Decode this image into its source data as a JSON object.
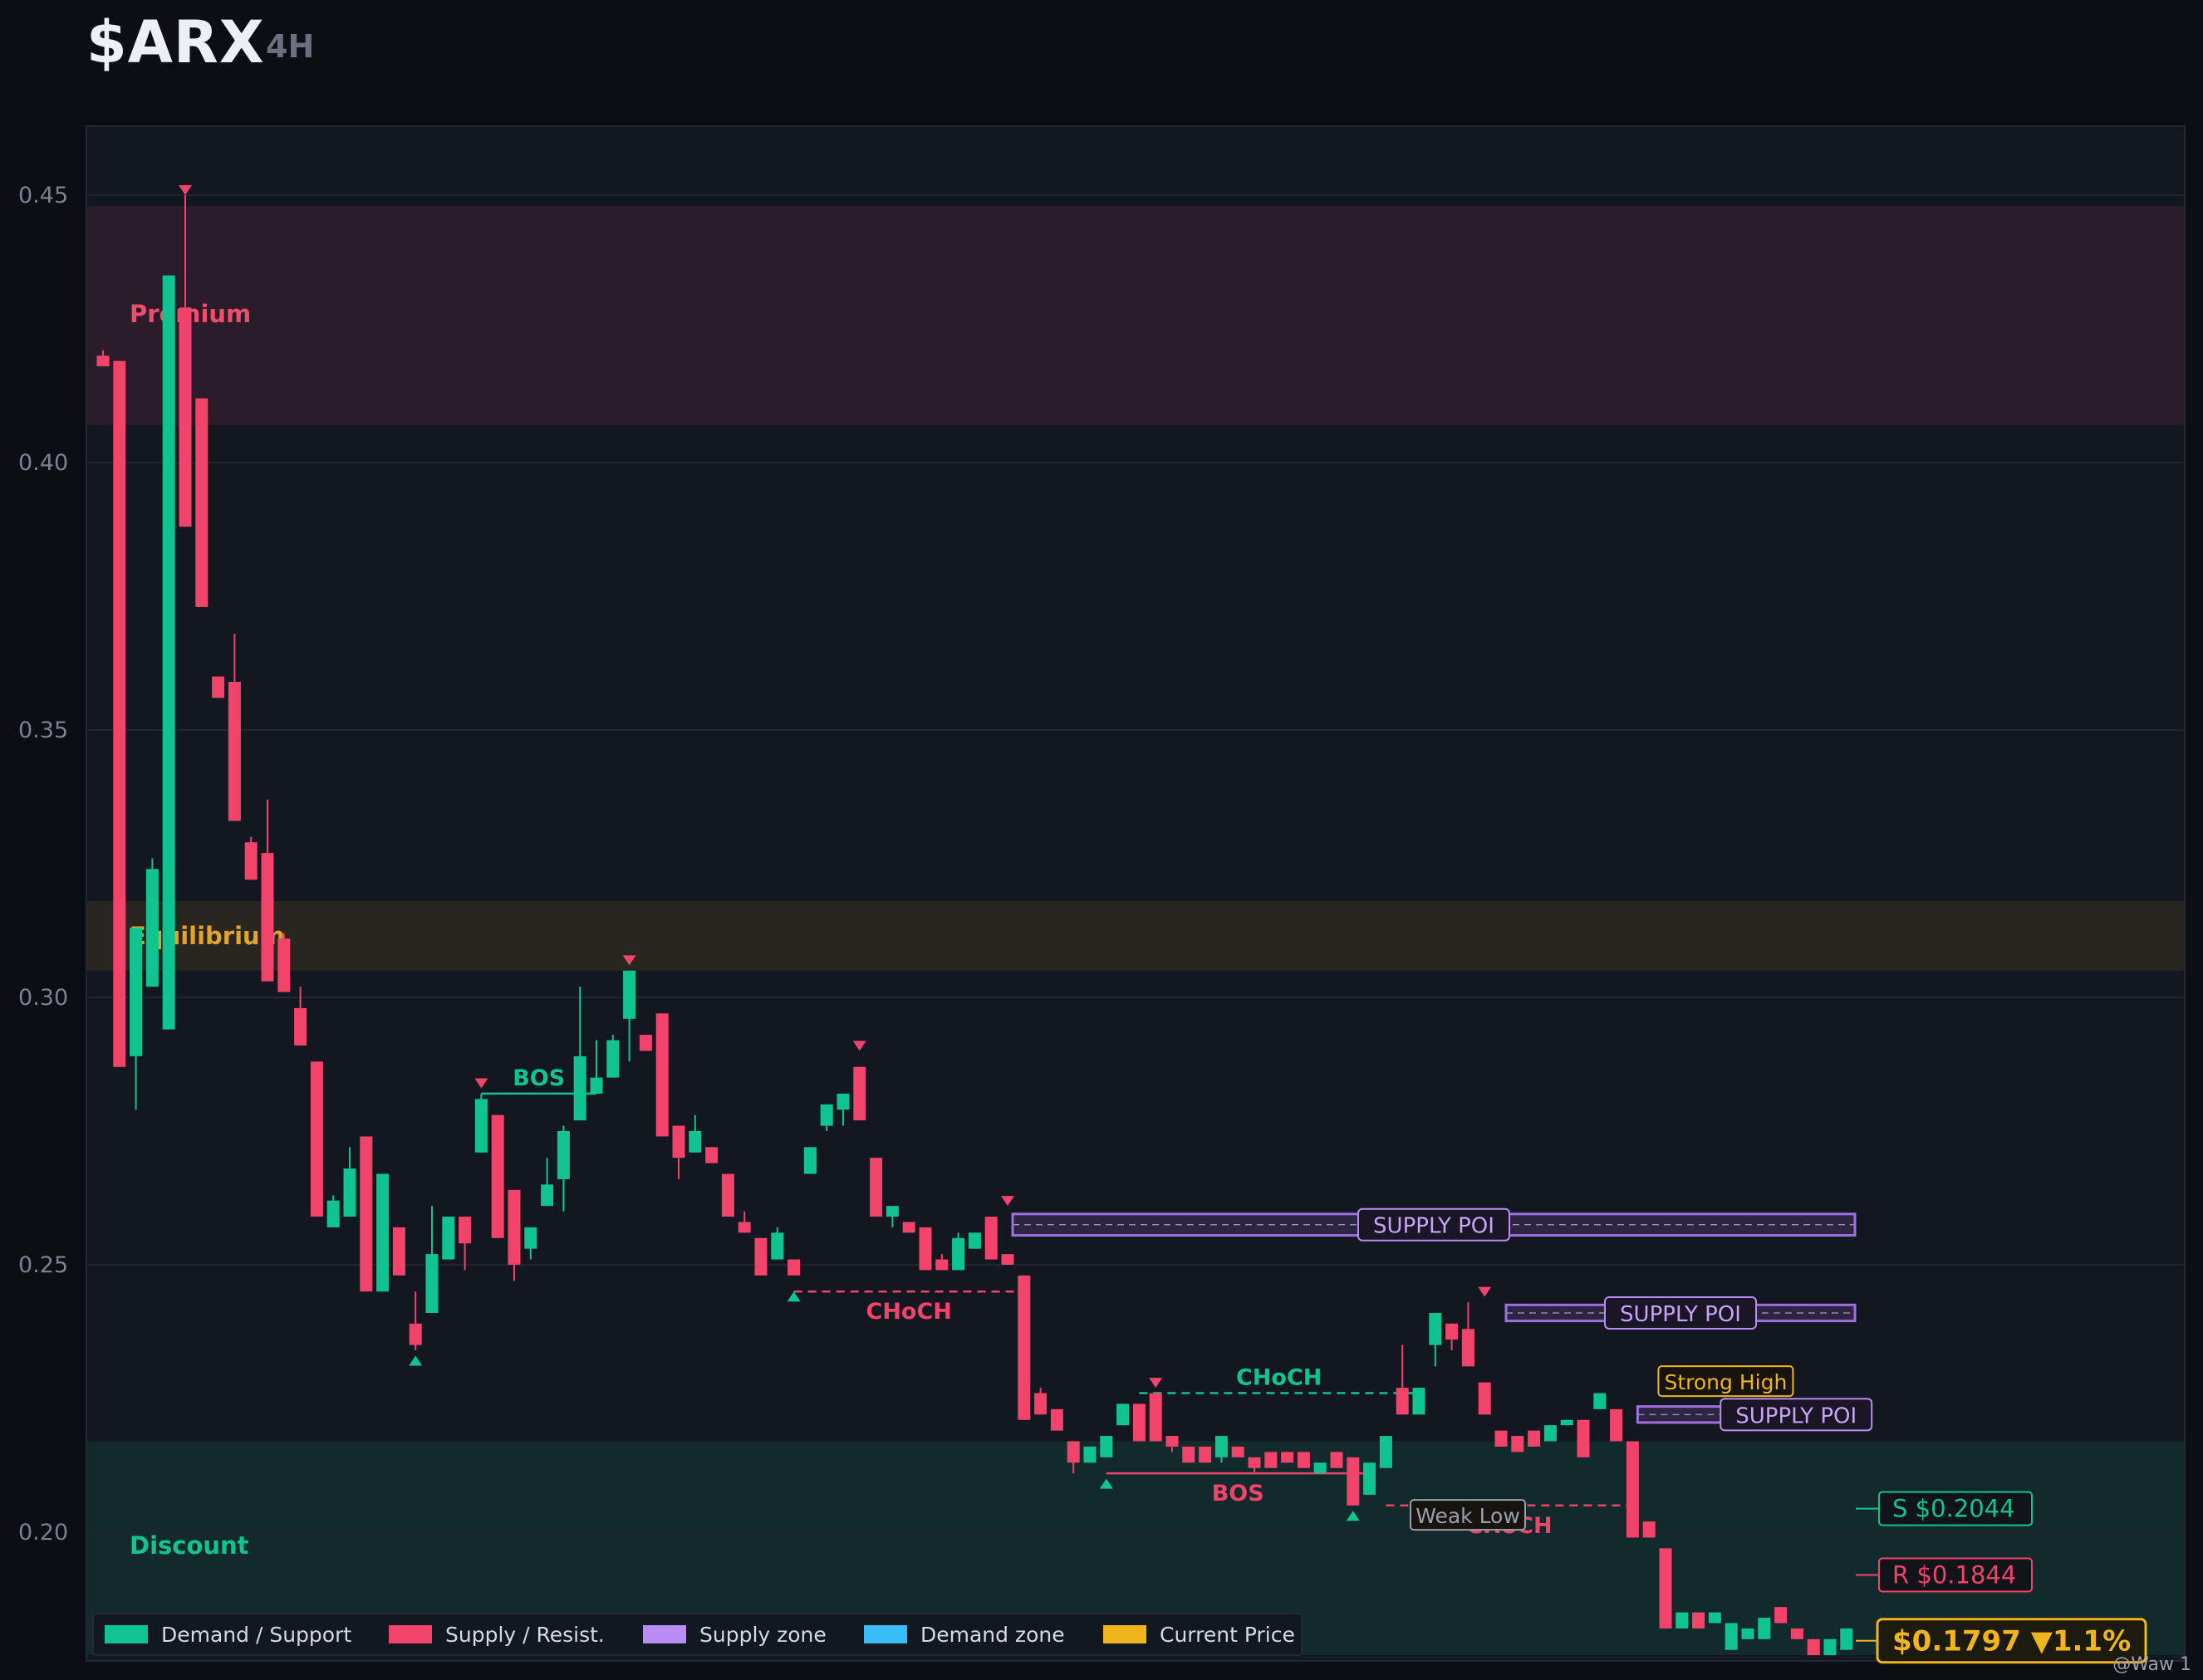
{
  "header": {
    "title": "$ARX",
    "timeframe": "4H"
  },
  "watermark": "@Waw 1",
  "colors": {
    "bull": "#10c490",
    "bear": "#f2436a",
    "supply": "#9f6fe0",
    "demand": "#38bdf8",
    "price": "#f0b41e",
    "premium": "#ef4d6c",
    "equilibrium": "#e0a52a",
    "discount": "#10c490"
  },
  "legend": [
    {
      "label": "Demand / Support",
      "color": "#10c490"
    },
    {
      "label": "Supply / Resist.",
      "color": "#f2436a"
    },
    {
      "label": "Supply zone",
      "color": "#b98cf4"
    },
    {
      "label": "Demand zone",
      "color": "#38bdf8"
    },
    {
      "label": "Current Price",
      "color": "#f0b41e"
    }
  ],
  "chart_data": {
    "type": "candlestick",
    "title": "$ARX",
    "interval": "4H",
    "ylim": [
      0.177,
      0.464
    ],
    "yticks": [
      0.2,
      0.25,
      0.3,
      0.35,
      0.4,
      0.45
    ],
    "ytick_labels": [
      "0.20",
      "0.25",
      "0.30",
      "0.35",
      "0.40",
      "0.45"
    ],
    "grid": true,
    "legend_position": "bottom-left",
    "candles": [
      [
        0.42,
        0.421,
        0.418,
        0.418
      ],
      [
        0.419,
        0.419,
        0.287,
        0.287
      ],
      [
        0.289,
        0.31,
        0.279,
        0.313
      ],
      [
        0.302,
        0.326,
        0.302,
        0.324
      ],
      [
        0.294,
        0.435,
        0.294,
        0.435
      ],
      [
        0.429,
        0.45,
        0.388,
        0.388
      ],
      [
        0.412,
        0.412,
        0.373,
        0.373
      ],
      [
        0.36,
        0.36,
        0.356,
        0.356
      ],
      [
        0.359,
        0.368,
        0.333,
        0.333
      ],
      [
        0.329,
        0.33,
        0.322,
        0.322
      ],
      [
        0.327,
        0.337,
        0.303,
        0.303
      ],
      [
        0.311,
        0.312,
        0.301,
        0.301
      ],
      [
        0.298,
        0.302,
        0.291,
        0.291
      ],
      [
        0.288,
        0.288,
        0.259,
        0.259
      ],
      [
        0.257,
        0.263,
        0.257,
        0.262
      ],
      [
        0.259,
        0.272,
        0.259,
        0.268
      ],
      [
        0.274,
        0.274,
        0.245,
        0.245
      ],
      [
        0.245,
        0.267,
        0.245,
        0.267
      ],
      [
        0.257,
        0.257,
        0.248,
        0.248
      ],
      [
        0.239,
        0.245,
        0.234,
        0.235
      ],
      [
        0.241,
        0.261,
        0.241,
        0.252
      ],
      [
        0.251,
        0.259,
        0.251,
        0.259
      ],
      [
        0.259,
        0.259,
        0.249,
        0.254
      ],
      [
        0.271,
        0.282,
        0.271,
        0.281
      ],
      [
        0.278,
        0.278,
        0.255,
        0.255
      ],
      [
        0.264,
        0.264,
        0.247,
        0.25
      ],
      [
        0.253,
        0.256,
        0.251,
        0.257
      ],
      [
        0.261,
        0.27,
        0.261,
        0.265
      ],
      [
        0.266,
        0.276,
        0.26,
        0.275
      ],
      [
        0.277,
        0.302,
        0.277,
        0.289
      ],
      [
        0.282,
        0.292,
        0.282,
        0.285
      ],
      [
        0.285,
        0.293,
        0.285,
        0.292
      ],
      [
        0.296,
        0.305,
        0.288,
        0.305
      ],
      [
        0.293,
        0.293,
        0.29,
        0.29
      ],
      [
        0.297,
        0.297,
        0.274,
        0.274
      ],
      [
        0.276,
        0.276,
        0.266,
        0.27
      ],
      [
        0.271,
        0.278,
        0.271,
        0.275
      ],
      [
        0.272,
        0.272,
        0.269,
        0.269
      ],
      [
        0.267,
        0.267,
        0.259,
        0.259
      ],
      [
        0.258,
        0.26,
        0.256,
        0.256
      ],
      [
        0.255,
        0.255,
        0.248,
        0.248
      ],
      [
        0.251,
        0.257,
        0.251,
        0.256
      ],
      [
        0.251,
        0.251,
        0.248,
        0.248
      ],
      [
        0.267,
        0.263,
        0.267,
        0.272
      ],
      [
        0.276,
        0.276,
        0.275,
        0.28
      ],
      [
        0.279,
        0.279,
        0.276,
        0.282
      ],
      [
        0.287,
        0.287,
        0.277,
        0.277
      ],
      [
        0.27,
        0.27,
        0.259,
        0.259
      ],
      [
        0.259,
        0.261,
        0.257,
        0.261
      ],
      [
        0.258,
        0.258,
        0.256,
        0.256
      ],
      [
        0.257,
        0.257,
        0.249,
        0.249
      ],
      [
        0.251,
        0.252,
        0.249,
        0.249
      ],
      [
        0.249,
        0.256,
        0.249,
        0.255
      ],
      [
        0.253,
        0.253,
        0.256,
        0.256
      ],
      [
        0.259,
        0.259,
        0.251,
        0.251
      ],
      [
        0.252,
        0.252,
        0.25,
        0.25
      ],
      [
        0.248,
        0.248,
        0.221,
        0.221
      ],
      [
        0.226,
        0.227,
        0.226,
        0.222
      ],
      [
        0.223,
        0.223,
        0.219,
        0.219
      ],
      [
        0.217,
        0.217,
        0.211,
        0.213
      ],
      [
        0.213,
        0.216,
        0.213,
        0.216
      ],
      [
        0.214,
        0.214,
        0.215,
        0.218
      ],
      [
        0.22,
        0.22,
        0.224,
        0.224
      ],
      [
        0.224,
        0.224,
        0.217,
        0.217
      ],
      [
        0.226,
        0.226,
        0.217,
        0.217
      ],
      [
        0.218,
        0.218,
        0.215,
        0.216
      ],
      [
        0.216,
        0.216,
        0.213,
        0.213
      ],
      [
        0.216,
        0.216,
        0.213,
        0.213
      ],
      [
        0.214,
        0.214,
        0.213,
        0.218
      ],
      [
        0.216,
        0.216,
        0.214,
        0.214
      ],
      [
        0.214,
        0.214,
        0.211,
        0.212
      ],
      [
        0.215,
        0.215,
        0.212,
        0.212
      ],
      [
        0.215,
        0.215,
        0.213,
        0.213
      ],
      [
        0.215,
        0.215,
        0.212,
        0.212
      ],
      [
        0.211,
        0.211,
        0.213,
        0.213
      ],
      [
        0.215,
        0.215,
        0.212,
        0.212
      ],
      [
        0.214,
        0.214,
        0.205,
        0.205
      ],
      [
        0.207,
        0.207,
        0.213,
        0.213
      ],
      [
        0.212,
        0.212,
        0.218,
        0.218
      ],
      [
        0.227,
        0.235,
        0.222,
        0.222
      ],
      [
        0.222,
        0.222,
        0.227,
        0.227
      ],
      [
        0.235,
        0.241,
        0.231,
        0.241
      ],
      [
        0.239,
        0.239,
        0.234,
        0.236
      ],
      [
        0.238,
        0.243,
        0.231,
        0.231
      ],
      [
        0.228,
        0.228,
        0.222,
        0.222
      ],
      [
        0.219,
        0.219,
        0.216,
        0.216
      ],
      [
        0.218,
        0.218,
        0.215,
        0.215
      ],
      [
        0.219,
        0.219,
        0.216,
        0.216
      ],
      [
        0.217,
        0.217,
        0.22,
        0.22
      ],
      [
        0.22,
        0.22,
        0.22,
        0.221
      ],
      [
        0.221,
        0.221,
        0.214,
        0.214
      ],
      [
        0.223,
        0.223,
        0.226,
        0.226
      ],
      [
        0.223,
        0.223,
        0.217,
        0.217
      ],
      [
        0.217,
        0.217,
        0.199,
        0.199
      ],
      [
        0.202,
        0.202,
        0.199,
        0.199
      ],
      [
        0.197,
        0.197,
        0.182,
        0.182
      ],
      [
        0.182,
        0.182,
        0.185,
        0.185
      ],
      [
        0.185,
        0.185,
        0.182,
        0.182
      ],
      [
        0.183,
        0.183,
        0.185,
        0.185
      ],
      [
        0.178,
        0.178,
        0.183,
        0.183
      ],
      [
        0.18,
        0.18,
        0.182,
        0.182
      ],
      [
        0.18,
        0.18,
        0.184,
        0.184
      ],
      [
        0.186,
        0.186,
        0.183,
        0.183
      ],
      [
        0.182,
        0.182,
        0.18,
        0.18
      ],
      [
        0.18,
        0.18,
        0.177,
        0.177
      ],
      [
        0.177,
        0.177,
        0.18,
        0.18
      ],
      [
        0.178,
        0.178,
        0.182,
        0.182
      ]
    ],
    "zones": [
      {
        "label": "Premium",
        "from": 0.407,
        "to": 0.448,
        "color": "#ef4d6c"
      },
      {
        "label": "Equilibrium",
        "from": 0.305,
        "to": 0.318,
        "color": "#e0a52a"
      },
      {
        "label": "Discount",
        "from": 0.177,
        "to": 0.217,
        "color": "#10c490"
      }
    ],
    "structure": [
      {
        "label": "BOS",
        "y": 0.282,
        "from": 23,
        "to": 30,
        "color": "#10c490",
        "dashed": false,
        "label_pos": "above"
      },
      {
        "label": "CHoCH",
        "y": 0.245,
        "from": 42,
        "to": 56,
        "color": "#f2436a",
        "dashed": true,
        "label_pos": "below"
      },
      {
        "label": "CHoCH",
        "y": 0.226,
        "from": 63,
        "to": 80,
        "color": "#10c490",
        "dashed": true,
        "label_pos": "above"
      },
      {
        "label": "BOS",
        "y": 0.211,
        "from": 61,
        "to": 77,
        "color": "#f2436a",
        "dashed": false,
        "label_pos": "below"
      },
      {
        "label": "CHoCH",
        "y": 0.205,
        "from": 78,
        "to": 93,
        "color": "#f2436a",
        "dashed": true,
        "label_pos": "below"
      }
    ],
    "supply_zones": [
      {
        "label": "SUPPLY POI",
        "from_index": 55,
        "low": 0.2555,
        "high": 0.2595
      },
      {
        "label": "SUPPLY POI",
        "from_index": 85,
        "low": 0.2395,
        "high": 0.2425
      },
      {
        "label": "SUPPLY POI",
        "from_index": 93,
        "low": 0.2205,
        "high": 0.2235
      }
    ],
    "swing_labels": [
      {
        "label": "Strong High",
        "x": 93,
        "y": 0.227,
        "color": "#f0b41e"
      },
      {
        "label": "Weak Low",
        "x": 80,
        "y": 0.202,
        "color": "#9aa0ab"
      }
    ],
    "swing_markers": [
      {
        "index": 5,
        "dir": "down",
        "y": 0.45
      },
      {
        "index": 19,
        "dir": "up",
        "y": 0.233
      },
      {
        "index": 23,
        "dir": "down",
        "y": 0.283
      },
      {
        "index": 32,
        "dir": "down",
        "y": 0.306
      },
      {
        "index": 42,
        "dir": "up",
        "y": 0.245
      },
      {
        "index": 46,
        "dir": "down",
        "y": 0.29
      },
      {
        "index": 55,
        "dir": "down",
        "y": 0.261
      },
      {
        "index": 61,
        "dir": "up",
        "y": 0.21
      },
      {
        "index": 64,
        "dir": "down",
        "y": 0.227
      },
      {
        "index": 76,
        "dir": "up",
        "y": 0.204
      },
      {
        "index": 84,
        "dir": "down",
        "y": 0.244
      }
    ],
    "price_tags": [
      {
        "text": "S $0.2044",
        "y": 0.2044,
        "color": "#10c490"
      },
      {
        "text": "R $0.1844",
        "y": 0.192,
        "color": "#f2436a"
      }
    ],
    "current_price": {
      "text": "$0.1797 ▼1.1%",
      "value": 0.1797
    }
  }
}
